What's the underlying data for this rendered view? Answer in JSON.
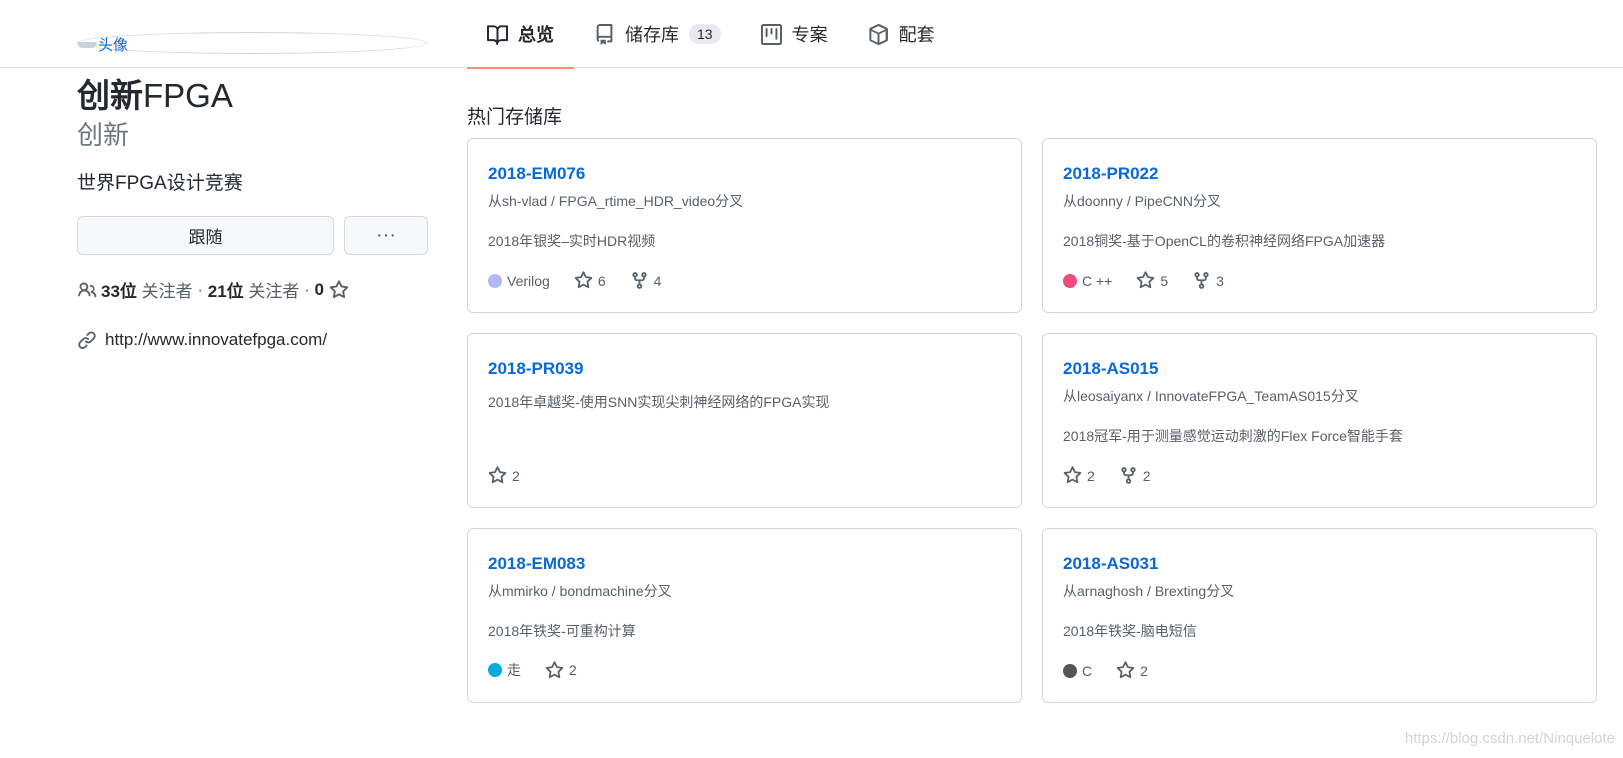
{
  "header": {
    "avatar_alt": "头像",
    "tabs": [
      {
        "label": "总览",
        "icon": "book-icon",
        "active": true
      },
      {
        "label": "储存库",
        "icon": "repo-icon",
        "counter": "13"
      },
      {
        "label": "专案",
        "icon": "project-icon"
      },
      {
        "label": "配套",
        "icon": "package-icon"
      }
    ]
  },
  "profile": {
    "name_cn": "创新",
    "name_en": "FPGA",
    "login": "创新",
    "bio": "世界FPGA设计竞赛",
    "follow_label": "跟随",
    "more_label": "···",
    "followers_count": "33位",
    "followers_label": "关注者",
    "following_count": "21位",
    "following_label": "关注者",
    "stars_count": "0",
    "website": "http://www.innovatefpga.com/"
  },
  "main": {
    "section_title": "热门存储库",
    "repos": [
      {
        "name": "2018-EM076",
        "fork": "从sh-vlad / FPGA_rtime_HDR_video分叉",
        "desc": "2018年银奖–实时HDR视频",
        "lang": "Verilog",
        "lang_color": "#b2b7f8",
        "stars": "6",
        "forks": "4"
      },
      {
        "name": "2018-PR022",
        "fork": "从doonny / PipeCNN分叉",
        "desc": "2018铜奖-基于OpenCL的卷积神经网络FPGA加速器",
        "lang": "C ++",
        "lang_color": "#f34b7d",
        "stars": "5",
        "forks": "3"
      },
      {
        "name": "2018-PR039",
        "fork": "",
        "desc": "2018年卓越奖-使用SNN实现尖刺神经网络的FPGA实现",
        "lang": "",
        "stars": "2",
        "forks": ""
      },
      {
        "name": "2018-AS015",
        "fork": "从leosaiyanx / InnovateFPGA_TeamAS015分叉",
        "desc": "2018冠军-用于测量感觉运动刺激的Flex Force智能手套",
        "lang": "",
        "stars": "2",
        "forks": "2"
      },
      {
        "name": "2018-EM083",
        "fork": "从mmirko / bondmachine分叉",
        "desc": "2018年铁奖-可重构计算",
        "lang": "走",
        "lang_color": "#00add8",
        "stars": "2",
        "forks": ""
      },
      {
        "name": "2018-AS031",
        "fork": "从arnaghosh / Brexting分叉",
        "desc": "2018年铁奖-脑电短信",
        "lang": "C",
        "lang_color": "#555555",
        "stars": "2",
        "forks": ""
      }
    ]
  },
  "watermark": "https://blog.csdn.net/Ninquelote"
}
